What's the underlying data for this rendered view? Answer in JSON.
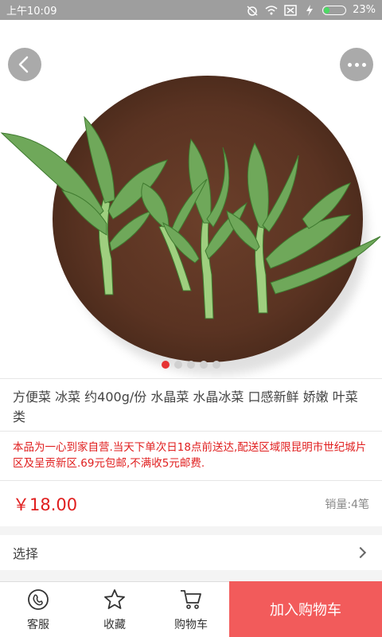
{
  "status_bar": {
    "time": "上午10:09",
    "battery_percent": "23%",
    "battery_level": 0.23,
    "icons": [
      "alarm-off-icon",
      "wifi-icon",
      "sim-icon",
      "charging-icon",
      "battery-icon"
    ]
  },
  "carousel": {
    "slide_count": 5,
    "active_index": 0
  },
  "product": {
    "title": "方便菜 冰菜 约400g/份 水晶菜 水晶冰菜 口感新鲜 娇嫩 叶菜类",
    "notice": "本品为一心到家自营.当天下单次日18点前送达,配送区域限昆明市世纪城片区及呈贡新区.69元包邮,不满收5元邮费.",
    "price": "￥18.00",
    "sales": "销量:4笔"
  },
  "options": {
    "select_label": "选择"
  },
  "bottom_bar": {
    "service_label": "客服",
    "favorite_label": "收藏",
    "cart_label": "购物车",
    "add_to_cart_label": "加入购物车"
  },
  "colors": {
    "accent": "#e01e1e",
    "cta_background": "#f25b5b",
    "status_bar": "#9e9e9e"
  }
}
